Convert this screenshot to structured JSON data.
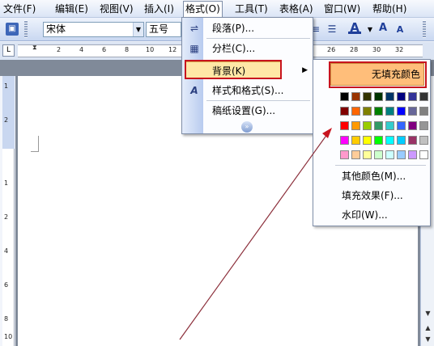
{
  "menubar": {
    "items": [
      "文件(F)",
      "编辑(E)",
      "视图(V)",
      "插入(I)",
      "格式(O)",
      "工具(T)",
      "表格(A)",
      "窗口(W)",
      "帮助(H)"
    ]
  },
  "toolbar": {
    "font_name": "宋体",
    "font_size": "五号",
    "font_color_glyph": "A",
    "grow_font_glyph": "A",
    "shrink_font_glyph": "A"
  },
  "ruler": {
    "corner": "L",
    "numbers": [
      "2",
      "4",
      "6",
      "8",
      "10",
      "12",
      "26",
      "28",
      "30",
      "32"
    ],
    "vertical_numbers": [
      "1",
      "2",
      "1",
      "2",
      "4",
      "6",
      "8",
      "10"
    ]
  },
  "format_menu": {
    "items": [
      {
        "label": "段落(P)...",
        "icon": "paragraph-icon"
      },
      {
        "label": "分栏(C)...",
        "icon": "columns-icon"
      },
      {
        "label": "背景(K)",
        "icon": "",
        "submenu": true
      },
      {
        "label": "样式和格式(S)...",
        "icon": "styles-icon"
      },
      {
        "label": "稿纸设置(G)...",
        "icon": ""
      }
    ]
  },
  "background_submenu": {
    "no_fill": "无填充颜色",
    "items": [
      "其他颜色(M)...",
      "填充效果(F)...",
      "水印(W)..."
    ],
    "swatches": [
      [
        "#000000",
        "#993300",
        "#333300",
        "#003300",
        "#003366",
        "#000080",
        "#333399",
        "#333333"
      ],
      [
        "#800000",
        "#ff6600",
        "#808000",
        "#008000",
        "#008080",
        "#0000ff",
        "#666699",
        "#808080"
      ],
      [
        "#ff0000",
        "#ff9900",
        "#99cc00",
        "#339966",
        "#33cccc",
        "#3366ff",
        "#800080",
        "#969696"
      ],
      [
        "#ff00ff",
        "#ffcc00",
        "#ffff00",
        "#00ff00",
        "#00ffff",
        "#00ccff",
        "#993366",
        "#c0c0c0"
      ],
      [
        "#ff99cc",
        "#ffcc99",
        "#ffff99",
        "#ccffcc",
        "#ccffff",
        "#99ccff",
        "#cc99ff",
        "#ffffff"
      ]
    ]
  },
  "colors": {
    "highlight": "#ffe7a6",
    "no_fill_bg": "#ffbe7a",
    "annotation_red": "#c8141e",
    "arrow": "#8b2e3a"
  }
}
